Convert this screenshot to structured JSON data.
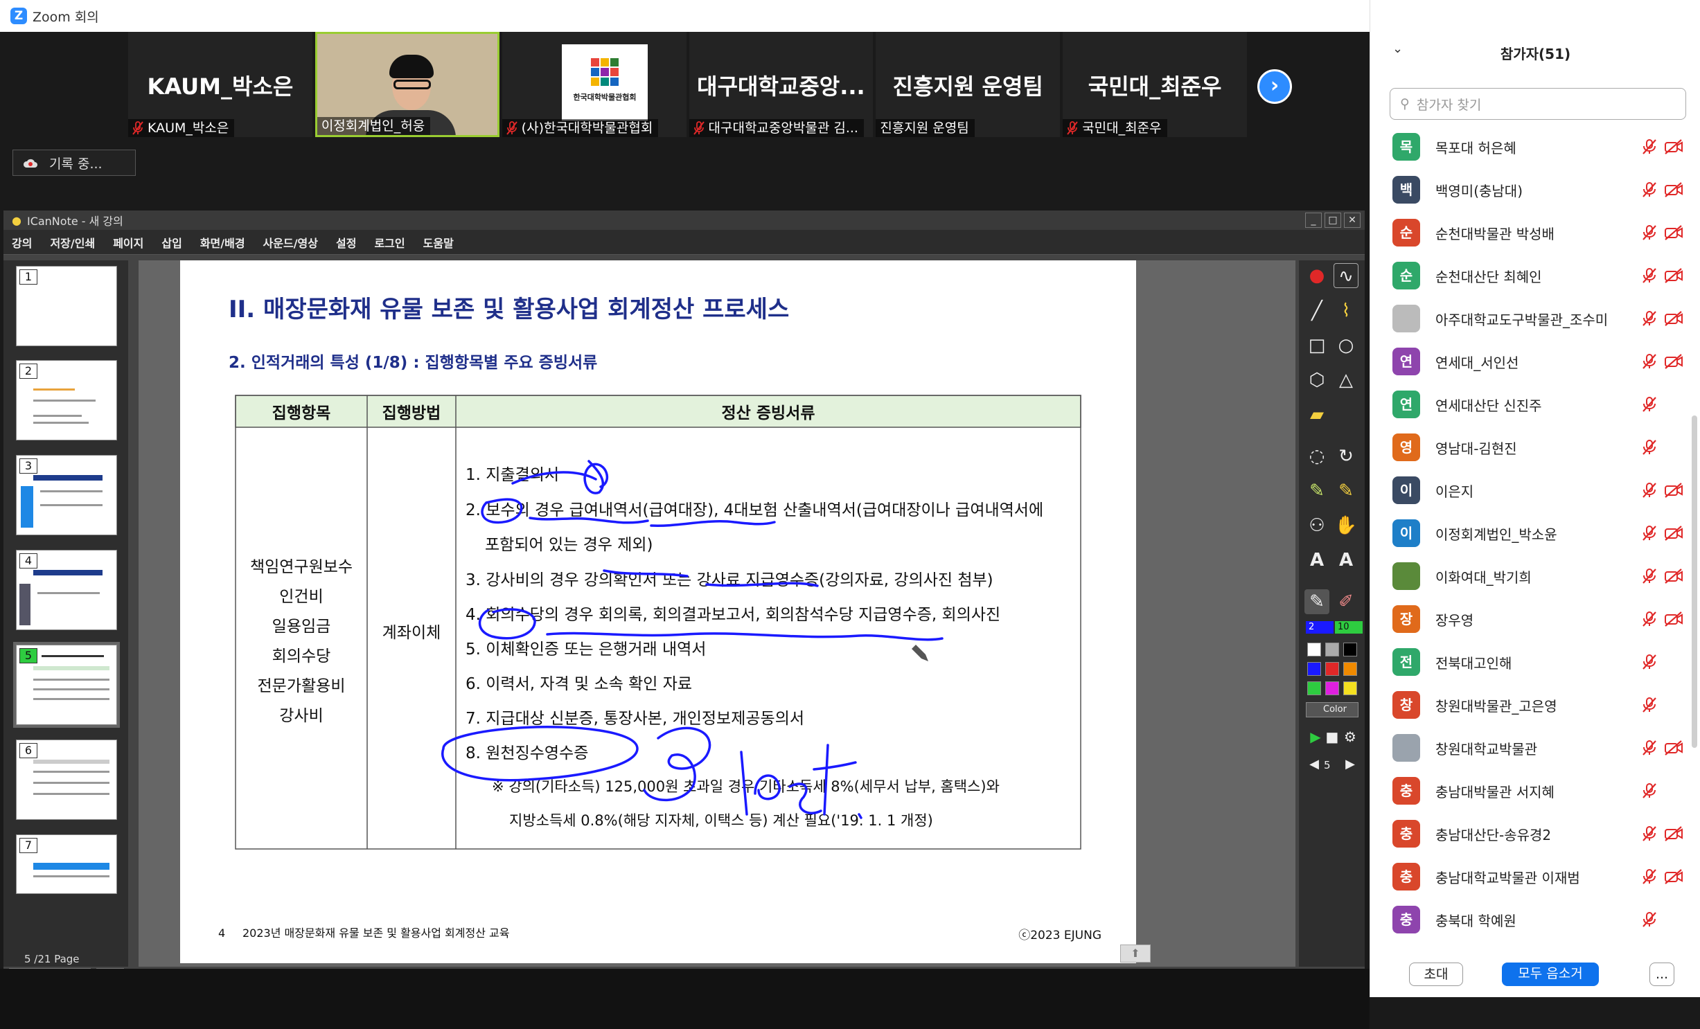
{
  "window": {
    "title": "Zoom 회의",
    "controls": [
      "—",
      "☐",
      "✕"
    ]
  },
  "strip": {
    "tiles": [
      {
        "big": "KAUM_박소은",
        "caption": "KAUM_박소은",
        "muted": true
      },
      {
        "big": "",
        "caption": "이정회계법인_허웅",
        "muted": false,
        "video": true
      },
      {
        "big": "",
        "caption": "(사)한국대학박물관협회",
        "muted": true,
        "logo": true,
        "logo_text": "한국대학박물관협회"
      },
      {
        "big": "대구대학교중앙...",
        "caption": "대구대학교중앙박물관 김...",
        "muted": true
      },
      {
        "big": "진흥지원 운영팀",
        "caption": "진흥지원 운영팀",
        "muted": false
      },
      {
        "big": "국민대_최준우",
        "caption": "국민대_최준우",
        "muted": true
      }
    ],
    "next_icon": "chevron-right-icon"
  },
  "recording": {
    "label": "기록 중..."
  },
  "icannote": {
    "title": "ICanNote - 새 강의",
    "menu": [
      "강의",
      "저장/인쇄",
      "페이지",
      "삽입",
      "화면/배경",
      "사운드/영상",
      "설정",
      "로그인",
      "도움말"
    ],
    "thumb_numbers": [
      "1",
      "2",
      "3",
      "4",
      "5",
      "6",
      "7"
    ],
    "page_info": "5 /21 Page",
    "pen_size": "2",
    "eraser_size": "10",
    "color_label": "Color",
    "page_num": "5"
  },
  "slide": {
    "title": "II. 매장문화재 유물 보존 및 활용사업 회계정산 프로세스",
    "subtitle": "2. 인적거래의 특성 (1/8) : 집행항목별 주요 증빙서류",
    "headers": [
      "집행항목",
      "집행방법",
      "정산 증빙서류"
    ],
    "items": [
      "책임연구원보수",
      "인건비",
      "일용임금",
      "회의수당",
      "전문가활용비",
      "강사비"
    ],
    "method": "계좌이체",
    "docs": [
      "1. 지출결의서",
      "2. 보수의 경우 급여내역서(급여대장), 4대보험 산출내역서(급여대장이나 급여내역서에",
      "포함되어 있는 경우 제외)",
      "3. 강사비의 경우 강의확인서 또는 강사료 지급영수증(강의자료, 강의사진 첨부)",
      "4. 회의수당의 경우 회의록, 회의결과보고서, 회의참석수당 지급영수증, 회의사진",
      "5. 이체확인증 또는 은행거래 내역서",
      "6. 이력서, 자격 및 소속 확인 자료",
      "7. 지급대상 신분증, 통장사본, 개인정보제공동의서",
      "8. 원천징수영수증",
      "※ 강의(기타소득) 125,000원 초과일 경우 기타소득세 8%(세무서 납부, 홈택스)와",
      "지방소득세 0.8%(해당 지자체, 이택스 등) 계산 필요('19. 1. 1 개정)"
    ],
    "footer_page": "4",
    "footer_text": "2023년 매장문화재 유물 보존 및 활용사업 회계정산 교육",
    "footer_copy": "ⓒ2023 EJUNG"
  },
  "panel": {
    "title": "참가자(51)",
    "search_placeholder": "참가자 찾기",
    "participants": [
      {
        "initial": "목",
        "name": "목포대 허은혜",
        "color": "#2fa86a",
        "video_off": true
      },
      {
        "initial": "백",
        "name": "백영미(충남대)",
        "color": "#3a4a63",
        "video_off": true
      },
      {
        "initial": "순",
        "name": "순천대박물관 박성배",
        "color": "#d9472b",
        "video_off": true
      },
      {
        "initial": "순",
        "name": "순천대산단 최혜인",
        "color": "#2fa86a",
        "video_off": true
      },
      {
        "initial": "",
        "name": "아주대학교도구박물관_조수미",
        "color": "#bbbbbb",
        "video_off": true,
        "photo": true
      },
      {
        "initial": "연",
        "name": "연세대_서인선",
        "color": "#8e44ad",
        "video_off": true
      },
      {
        "initial": "연",
        "name": "연세대산단 신진주",
        "color": "#2fa86a",
        "video_off": false
      },
      {
        "initial": "영",
        "name": "영남대-김현진",
        "color": "#e06a1b",
        "video_off": false
      },
      {
        "initial": "이",
        "name": "이은지",
        "color": "#3a4a63",
        "video_off": true
      },
      {
        "initial": "이",
        "name": "이정회계법인_박소윤",
        "color": "#1e7fc8",
        "video_off": true
      },
      {
        "initial": "",
        "name": "이화여대_박기희",
        "color": "#5a8a3a",
        "video_off": true,
        "photo": true
      },
      {
        "initial": "장",
        "name": "장우영",
        "color": "#e06a1b",
        "video_off": true
      },
      {
        "initial": "전",
        "name": "전북대고인해",
        "color": "#2fa86a",
        "video_off": false
      },
      {
        "initial": "창",
        "name": "창원대박물관_고은영",
        "color": "#d9472b",
        "video_off": false
      },
      {
        "initial": "",
        "name": "창원대학교박물관",
        "color": "#9aa3ad",
        "video_off": true,
        "default": true
      },
      {
        "initial": "충",
        "name": "충남대박물관 서지혜",
        "color": "#d9472b",
        "video_off": false
      },
      {
        "initial": "충",
        "name": "충남대산단-송유경2",
        "color": "#d9472b",
        "video_off": true
      },
      {
        "initial": "충",
        "name": "충남대학교박물관 이재범",
        "color": "#d9472b",
        "video_off": true
      },
      {
        "initial": "충",
        "name": "충북대 학예원",
        "color": "#8e44ad",
        "video_off": false
      }
    ],
    "buttons": {
      "invite": "초대",
      "mute_all": "모두 음소거",
      "more": "..."
    }
  }
}
